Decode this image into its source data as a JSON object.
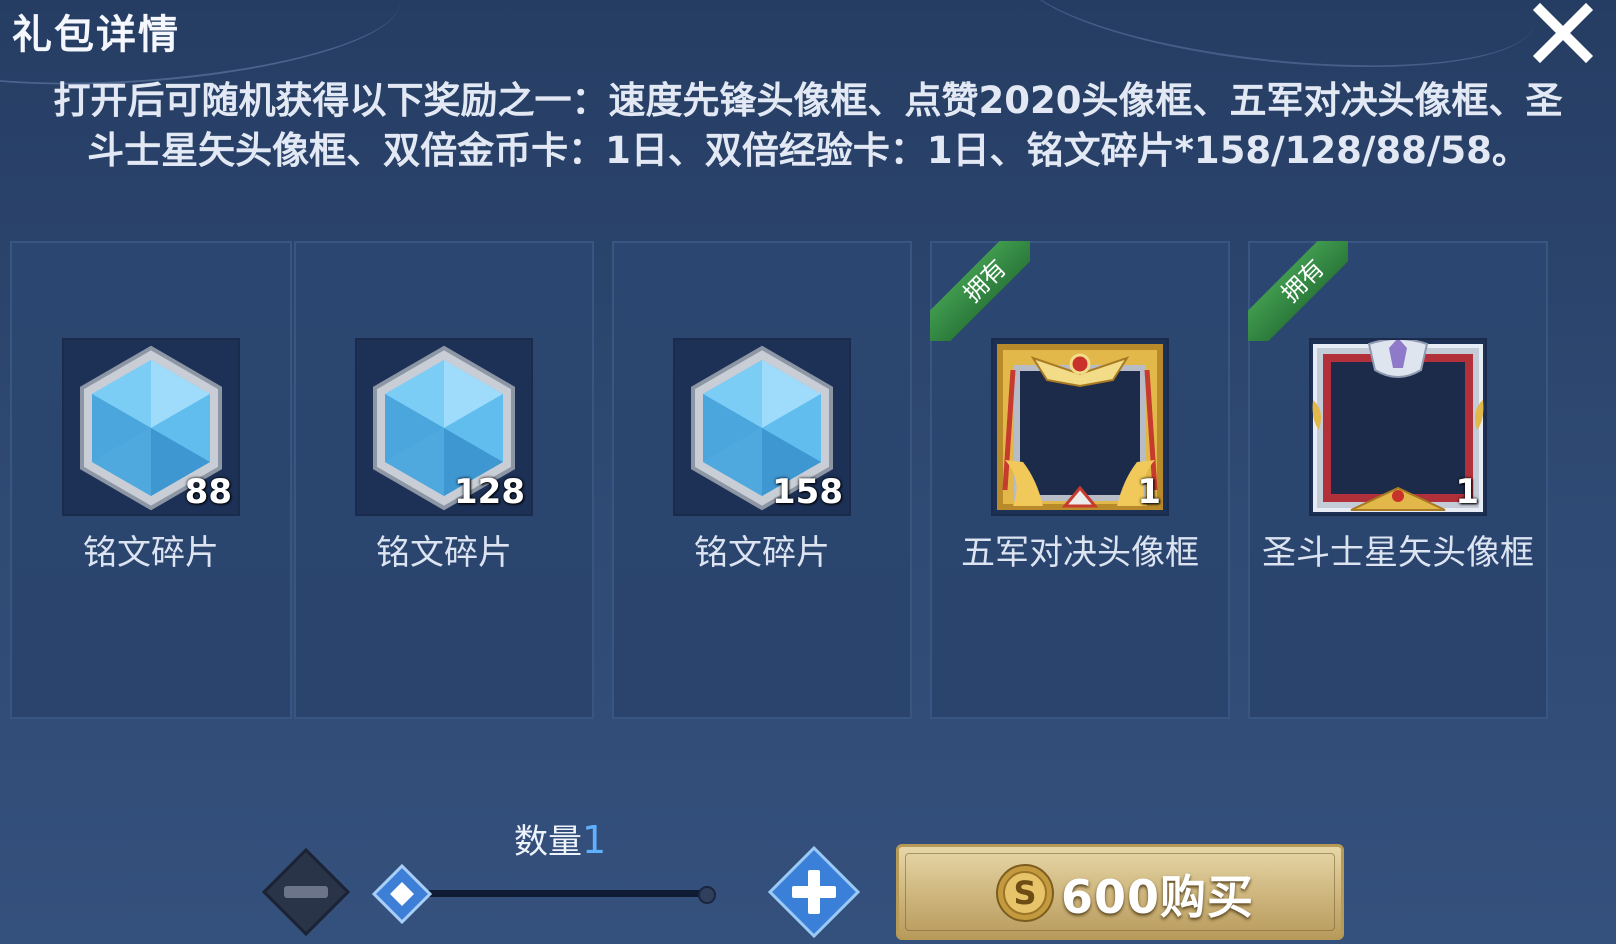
{
  "dialog": {
    "title": "礼包详情",
    "description": "打开后可随机获得以下奖励之一：速度先锋头像框、点赞2020头像框、五军对决头像框、圣斗士星矢头像框、双倍金币卡：1日、双倍经验卡：1日、铭文碎片*158/128/88/58。"
  },
  "rewards": [
    {
      "name": "铭文碎片",
      "count": "88",
      "icon": "inscription-crystal-icon",
      "owned_label": ""
    },
    {
      "name": "铭文碎片",
      "count": "128",
      "icon": "inscription-crystal-icon",
      "owned_label": ""
    },
    {
      "name": "铭文碎片",
      "count": "158",
      "icon": "inscription-crystal-icon",
      "owned_label": ""
    },
    {
      "name": "五军对决头像框",
      "count": "1",
      "icon": "gold-avatar-frame-icon",
      "owned_label": "拥有"
    },
    {
      "name": "圣斗士星矢头像框",
      "count": "1",
      "icon": "silver-avatar-frame-icon",
      "owned_label": "拥有"
    }
  ],
  "quantity": {
    "label": "数量",
    "value": "1",
    "slider_fraction": 0
  },
  "buy": {
    "label": "600购买",
    "currency_icon": "coin-icon"
  },
  "colors": {
    "background": "#2f4a74",
    "owned_ribbon": "#3f9a4e",
    "quantity_value": "#5fb0ff",
    "buy_button": "#cdb57c"
  }
}
